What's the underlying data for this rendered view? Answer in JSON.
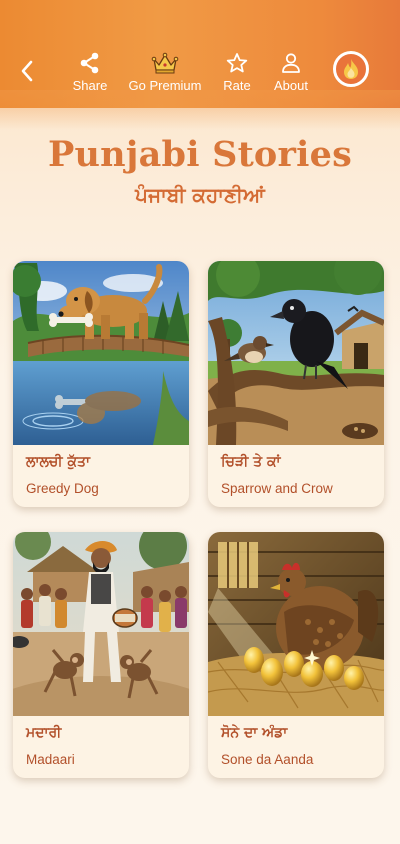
{
  "topbar": {
    "back_icon": "chevron-left-icon",
    "items": [
      {
        "label": "Share",
        "icon": "share-icon"
      },
      {
        "label": "Go Premium",
        "icon": "crown-icon"
      },
      {
        "label": "Rate",
        "icon": "star-icon"
      },
      {
        "label": "About",
        "icon": "person-icon"
      }
    ],
    "fire_icon": "fire-icon",
    "colors": {
      "bar_start": "#ec8a32",
      "bar_end": "#e77a3a"
    }
  },
  "header": {
    "title": "Punjabi Stories",
    "subtitle": "ਪੰਜਾਬੀ ਕਹਾਣੀਆਂ",
    "title_color": "#d9773a"
  },
  "stories": [
    {
      "punjabi": "ਲਾਲਚੀ ਕੁੱਤਾ",
      "english": "Greedy Dog",
      "image": "dog-on-bridge-with-bone"
    },
    {
      "punjabi": "ਚਿੜੀ ਤੇ ਕਾਂ",
      "english": "Sparrow and Crow",
      "image": "sparrow-and-crow-on-branch"
    },
    {
      "punjabi": "ਮਦਾਰੀ",
      "english": "Madaari",
      "image": "madaari-with-monkeys"
    },
    {
      "punjabi": "ਸੋਨੇ ਦਾ ਅੰਡਾ",
      "english": "Sone da Aanda",
      "image": "hen-with-golden-eggs"
    }
  ]
}
